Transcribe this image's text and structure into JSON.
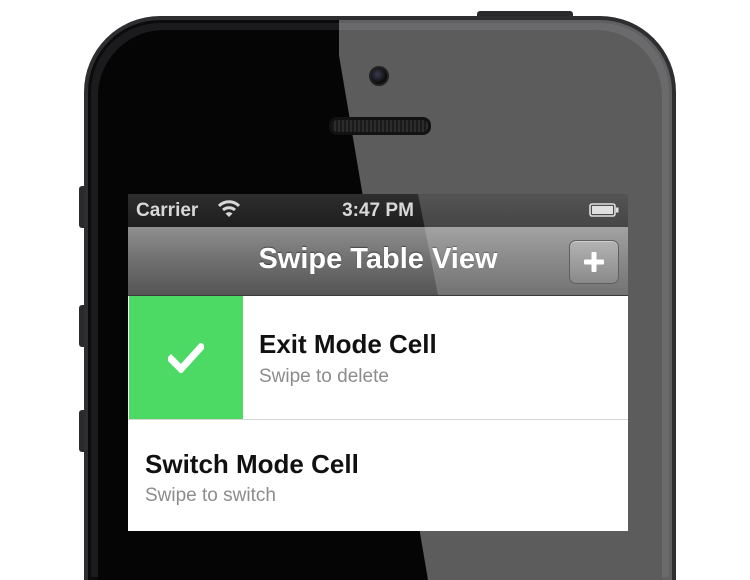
{
  "status_bar": {
    "carrier": "Carrier",
    "time": "3:47 PM"
  },
  "nav_bar": {
    "title": "Swipe Table View",
    "add_icon": "plus-icon"
  },
  "cells": [
    {
      "title": "Exit Mode Cell",
      "subtitle": "Swipe to delete",
      "action_icon": "checkmark-icon",
      "action_color": "#4cd964"
    },
    {
      "title": "Switch Mode Cell",
      "subtitle": "Swipe to switch"
    }
  ],
  "colors": {
    "swipe_action": "#4cd964",
    "nav_bar": "#7a7a7a",
    "status_bar": "#262626"
  }
}
